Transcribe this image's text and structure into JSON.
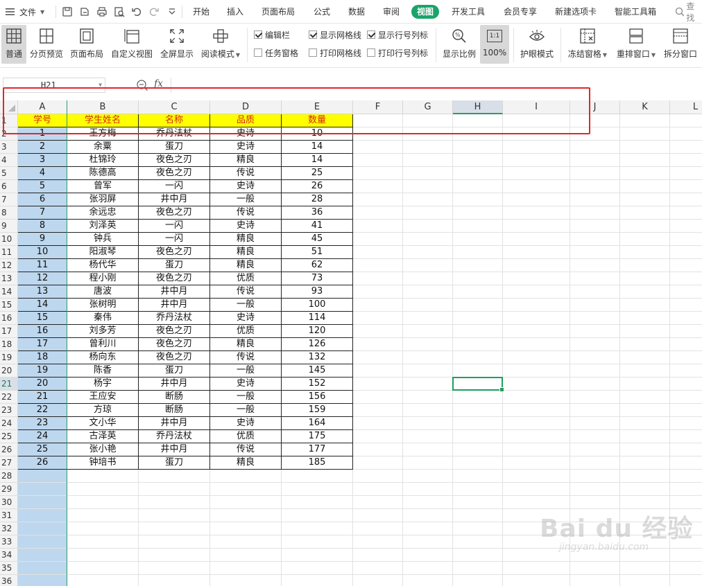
{
  "menubar": {
    "file_label": "文件",
    "tabs": [
      "开始",
      "插入",
      "页面布局",
      "公式",
      "数据",
      "审阅",
      "视图",
      "开发工具",
      "会员专享",
      "新建选项卡",
      "智能工具箱"
    ],
    "active_tab": "视图",
    "search_label": "查找"
  },
  "ribbon": {
    "views": [
      {
        "label": "普通",
        "icon": "grid-view-icon",
        "active": true
      },
      {
        "label": "分页预览",
        "icon": "page-break-preview-icon"
      },
      {
        "label": "页面布局",
        "icon": "page-layout-icon"
      },
      {
        "label": "自定义视图",
        "icon": "custom-view-icon"
      },
      {
        "label": "全屏显示",
        "icon": "fullscreen-icon"
      },
      {
        "label": "阅读模式",
        "icon": "reading-mode-icon"
      }
    ],
    "checks": [
      {
        "label": "编辑栏",
        "checked": true
      },
      {
        "label": "任务窗格",
        "checked": false
      },
      {
        "label": "显示网格线",
        "checked": true
      },
      {
        "label": "打印网格线",
        "checked": false
      },
      {
        "label": "显示行号列标",
        "checked": true
      },
      {
        "label": "打印行号列标",
        "checked": false
      }
    ],
    "zoom_label": "显示比例",
    "zoom_100_label": "100%",
    "zoom_100_icon_text": "1:1",
    "eye_label": "护眼模式",
    "freeze_label": "冻结窗格",
    "arrange_label": "重排窗口",
    "split_label": "拆分窗口"
  },
  "formula_bar": {
    "name_box": "H21",
    "fx_label": "fx",
    "formula": ""
  },
  "sheet": {
    "columns": [
      "A",
      "B",
      "C",
      "D",
      "E",
      "F",
      "G",
      "H",
      "I",
      "J",
      "K",
      "L"
    ],
    "selected_column": "H",
    "selected_row": 21,
    "row_numbers": [
      1,
      2,
      3,
      4,
      5,
      6,
      7,
      8,
      9,
      10,
      11,
      12,
      13,
      14,
      15,
      16,
      17,
      18,
      19,
      20,
      21,
      22,
      23,
      24,
      25,
      26,
      27,
      28,
      29,
      30,
      31,
      32,
      33,
      34,
      35,
      36
    ],
    "header": [
      "学号",
      "学生姓名",
      "名称",
      "品质",
      "数量"
    ],
    "rows": [
      [
        "1",
        "王方梅",
        "乔丹法杖",
        "史诗",
        "10"
      ],
      [
        "2",
        "余粟",
        "蛋刀",
        "史诗",
        "14"
      ],
      [
        "3",
        "杜锦玲",
        "夜色之刃",
        "精良",
        "14"
      ],
      [
        "4",
        "陈德高",
        "夜色之刃",
        "传说",
        "25"
      ],
      [
        "5",
        "曾军",
        "一闪",
        "史诗",
        "26"
      ],
      [
        "6",
        "张羽屏",
        "井中月",
        "一般",
        "28"
      ],
      [
        "7",
        "余远忠",
        "夜色之刃",
        "传说",
        "36"
      ],
      [
        "8",
        "刘泽英",
        "一闪",
        "史诗",
        "41"
      ],
      [
        "9",
        "钟兵",
        "一闪",
        "精良",
        "45"
      ],
      [
        "10",
        "阳淑琴",
        "夜色之刃",
        "精良",
        "51"
      ],
      [
        "11",
        "杨代华",
        "蛋刀",
        "精良",
        "62"
      ],
      [
        "12",
        "程小刚",
        "夜色之刃",
        "优质",
        "73"
      ],
      [
        "13",
        "唐波",
        "井中月",
        "传说",
        "93"
      ],
      [
        "14",
        "张树明",
        "井中月",
        "一般",
        "100"
      ],
      [
        "15",
        "秦伟",
        "乔丹法杖",
        "史诗",
        "114"
      ],
      [
        "16",
        "刘多芳",
        "夜色之刃",
        "优质",
        "120"
      ],
      [
        "17",
        "曾利川",
        "夜色之刃",
        "精良",
        "126"
      ],
      [
        "18",
        "杨向东",
        "夜色之刃",
        "传说",
        "132"
      ],
      [
        "19",
        "陈香",
        "蛋刀",
        "一般",
        "145"
      ],
      [
        "20",
        "杨宇",
        "井中月",
        "史诗",
        "152"
      ],
      [
        "21",
        "王应安",
        "断肠",
        "一般",
        "156"
      ],
      [
        "22",
        "方琼",
        "断肠",
        "一般",
        "159"
      ],
      [
        "23",
        "文小华",
        "井中月",
        "史诗",
        "164"
      ],
      [
        "24",
        "古泽英",
        "乔丹法杖",
        "优质",
        "175"
      ],
      [
        "25",
        "张小艳",
        "井中月",
        "传说",
        "177"
      ],
      [
        "26",
        "钟培书",
        "蛋刀",
        "精良",
        "185"
      ]
    ]
  },
  "colors": {
    "accent": "#1aa36a",
    "header_fill": "#ffff00",
    "header_text": "#d62b12",
    "id_column_fill": "#bdd7ee",
    "annotation": "#e0262b"
  },
  "watermark": {
    "main": "Bai du 经验",
    "sub": "jingyan.baidu.com"
  }
}
